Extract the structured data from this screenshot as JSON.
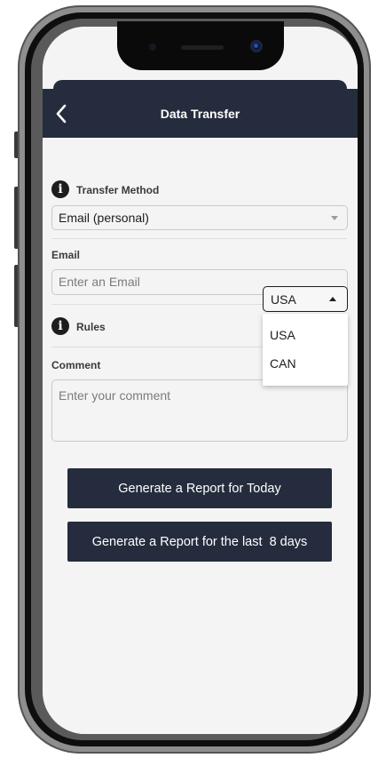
{
  "header": {
    "title": "Data Transfer"
  },
  "transfer_method": {
    "label": "Transfer Method",
    "value": "Email (personal)"
  },
  "email": {
    "label": "Email",
    "placeholder": "Enter an Email"
  },
  "rules": {
    "label": "Rules",
    "selected": "USA",
    "options": [
      "USA",
      "CAN"
    ]
  },
  "comment": {
    "label": "Comment",
    "placeholder": "Enter your comment"
  },
  "buttons": {
    "today": "Generate a Report for Today",
    "last_days": "Generate a Report for the last  8 days"
  },
  "icons": {
    "back": "chevron-left-icon",
    "info": "info-icon",
    "dropdown": "caret-down-icon",
    "select": "caret-up-icon"
  },
  "colors": {
    "header": "#252c3d",
    "button": "#252c3d",
    "background": "#f4f4f4"
  }
}
